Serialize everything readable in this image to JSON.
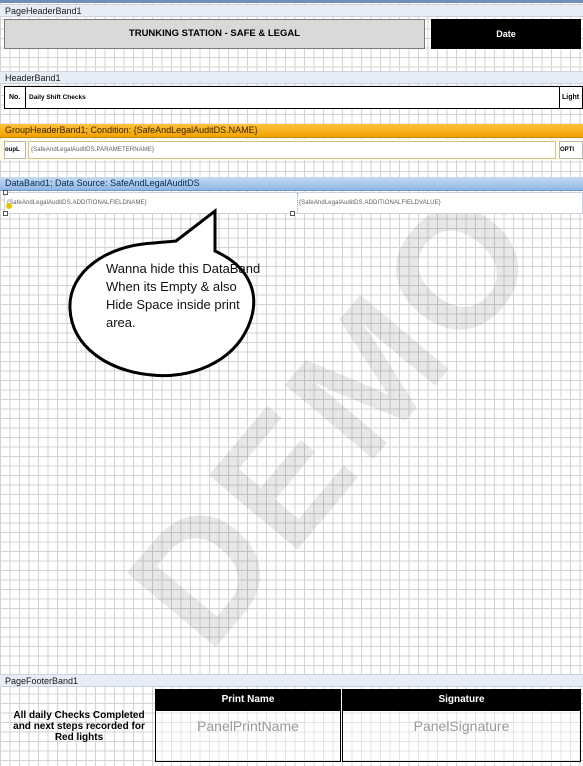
{
  "bands": {
    "page_header": "PageHeaderBand1",
    "header": "HeaderBand1",
    "group_header": "GroupHeaderBand1; Condition: {SafeAndLegalAuditDS.NAME}",
    "data_band": "DataBand1; Data Source: SafeAndLegalAuditDS",
    "page_footer": "PageFooterBand1"
  },
  "page_header": {
    "title": "TRUNKING STATION - SAFE & LEGAL",
    "date_label": "Date"
  },
  "header": {
    "no": "No.",
    "daily": "Daily Shift Checks",
    "light": "Light"
  },
  "group_header": {
    "left_cut": "oupL",
    "param": "{SafeAndLegalAuditDS.PARAMETERNAME}",
    "right_cut": "OPTI"
  },
  "data_band": {
    "field_name": "{SafeAndLegalAuditDS.ADDITIONALFIELDNAME}",
    "field_value": "{SafeAndLegalAuditDS.ADDITIONALFIELDVALUE}"
  },
  "annotation": "Wanna hide this DataBand When its Empty & also Hide Space inside print area.",
  "watermark": "DEMO",
  "footer": {
    "note": "All daily Checks Completed and next steps recorded for Red lights",
    "print_name_header": "Print Name",
    "signature_header": "Signature",
    "print_name_panel": "PanelPrintName",
    "signature_panel": "PanelSignature"
  },
  "colors": {
    "group_band": "#f2a100",
    "data_band": "#8fb6e6",
    "header_black": "#000000",
    "title_gray": "#d9d9d9"
  }
}
